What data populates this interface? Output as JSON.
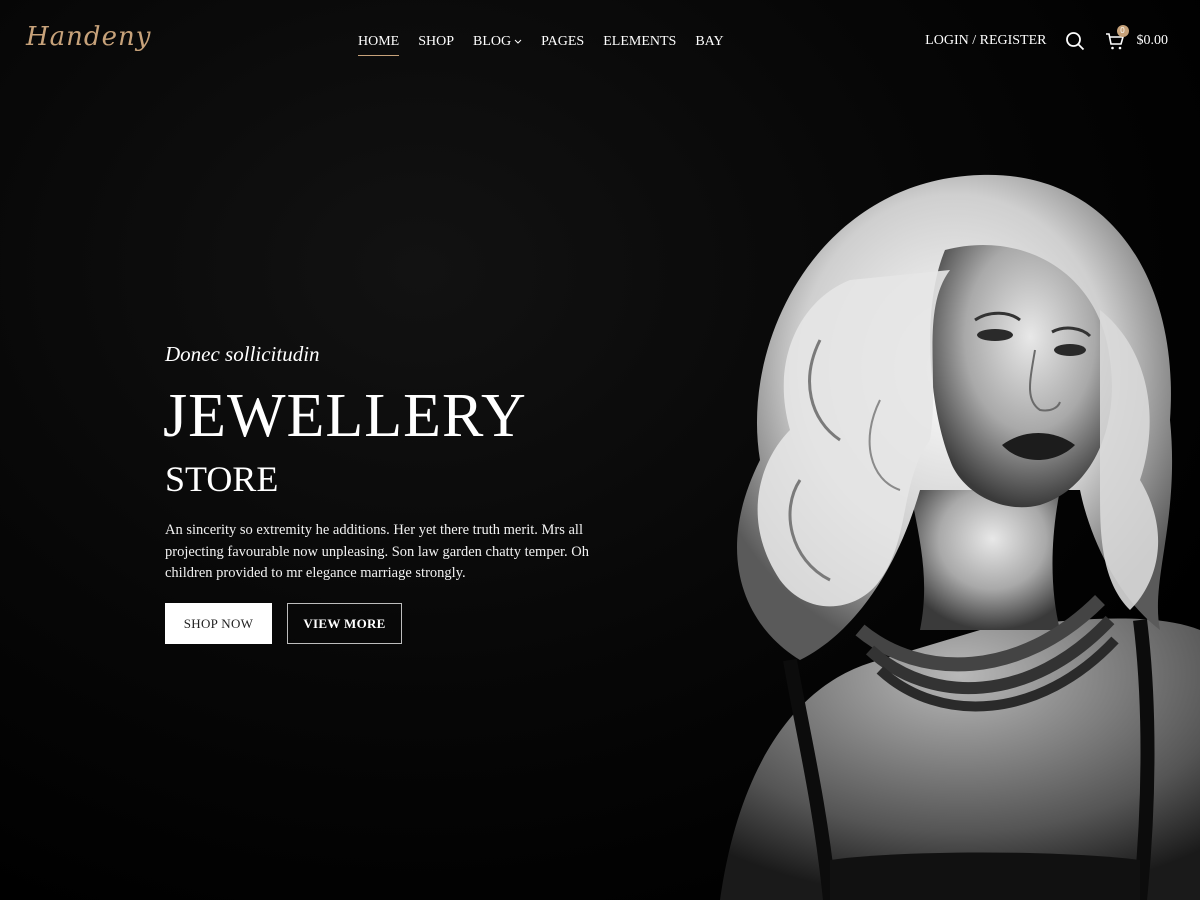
{
  "brand": {
    "logo_text": "Handeny",
    "accent": "#c7a27a"
  },
  "nav": {
    "items": [
      {
        "label": "HOME",
        "active": true
      },
      {
        "label": "SHOP"
      },
      {
        "label": "BLOG",
        "has_dropdown": true
      },
      {
        "label": "PAGES"
      },
      {
        "label": "ELEMENTS"
      },
      {
        "label": "BAY"
      }
    ]
  },
  "header_tools": {
    "login_label": "LOGIN / REGISTER",
    "search_icon": "search-icon",
    "cart_icon": "cart-icon",
    "cart_count": "0",
    "cart_total": "$0.00"
  },
  "hero": {
    "eyebrow": "Donec sollicitudin",
    "title": "JEWELLERY",
    "subtitle": "STORE",
    "description": "An sincerity so extremity he additions. Her yet there truth merit. Mrs all projecting favourable now unpleasing. Son law garden chatty temper. Oh children provided to mr elegance marriage strongly.",
    "primary_button": "SHOP NOW",
    "secondary_button": "VIEW MORE"
  }
}
